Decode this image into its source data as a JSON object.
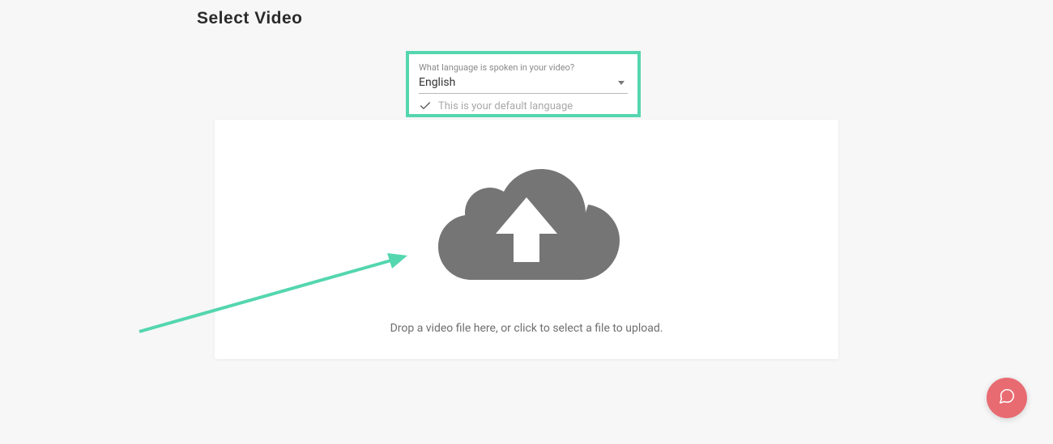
{
  "page": {
    "title": "Select Video"
  },
  "language": {
    "label": "What language is spoken in your video?",
    "selected": "English",
    "default_message": "This is your default language"
  },
  "upload": {
    "instruction": "Drop a video file here, or click to select a file to upload."
  }
}
